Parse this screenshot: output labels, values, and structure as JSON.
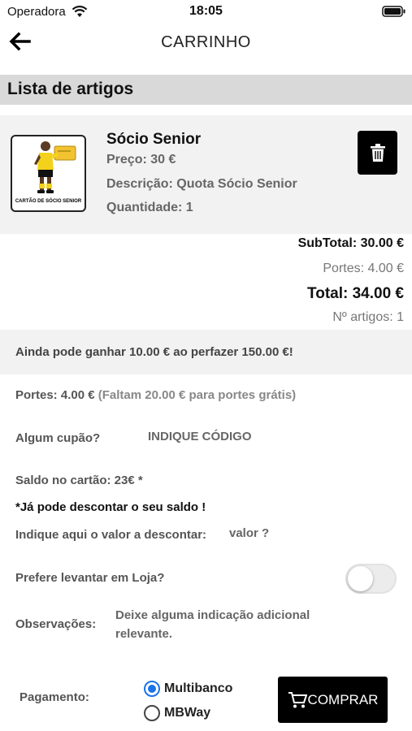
{
  "status_bar": {
    "carrier": "Operadora",
    "time": "18:05"
  },
  "nav": {
    "title": "CARRINHO"
  },
  "list_header": "Lista de artigos",
  "items": [
    {
      "name": "Sócio Senior",
      "price": "Preço: 30 €",
      "description": "Descrição: Quota Sócio Senior",
      "quantity": "Quantidade: 1",
      "thumbnail_caption": "CARTÃO DE SÓCIO SENIOR"
    }
  ],
  "totals": {
    "subtotal": "SubTotal: 30.00 €",
    "portes": "Portes: 4.00 €",
    "total": "Total: 34.00 €",
    "count": "Nº artigos: 1"
  },
  "promo": "Ainda pode ganhar 10.00 € ao perfazer 150.00 €!",
  "shipping": {
    "label": "Portes: 4.00 €",
    "note": "(Faltam 20.00 € para portes grátis)"
  },
  "coupon": {
    "label": "Algum cupão?",
    "placeholder": "INDIQUE CÓDIGO"
  },
  "balance": {
    "label": "Saldo no cartão: 23€ *",
    "notice": "*Já pode descontar o seu saldo !",
    "discount_label": "Indique aqui o valor a descontar:",
    "discount_placeholder": "valor ?"
  },
  "pickup": {
    "label": "Prefere levantar em Loja?",
    "enabled": false
  },
  "observations": {
    "label": "Observações:",
    "placeholder": "Deixe alguma indicação adicional relevante."
  },
  "payment": {
    "label": "Pagamento:",
    "options": [
      "Multibanco",
      "MBWay"
    ],
    "selected": "Multibanco"
  },
  "buy_button": "COMPRAR",
  "colors": {
    "accent": "#1a73e8",
    "button_bg": "#000000",
    "section_bg": "#d9d9d9",
    "card_bg": "#f2f2f2"
  }
}
